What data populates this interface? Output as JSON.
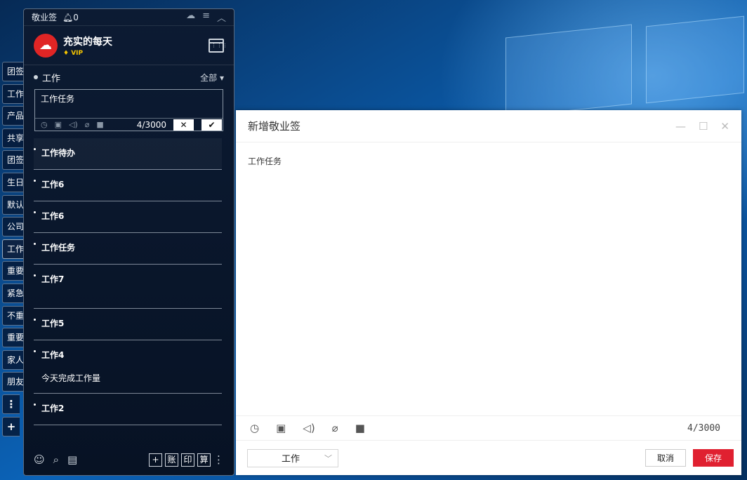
{
  "app": {
    "title": "敬业签",
    "notif_count": "0",
    "user_name": "充实的每天",
    "vip_label": "VIP"
  },
  "side_tabs": [
    {
      "label": "团签"
    },
    {
      "label": "工作"
    },
    {
      "label": "产品"
    },
    {
      "label": "共享"
    },
    {
      "label": "团签"
    },
    {
      "label": "生日"
    },
    {
      "label": "默认"
    },
    {
      "label": "公司"
    },
    {
      "label": "工作"
    },
    {
      "label": "重要"
    },
    {
      "label": "紧急"
    },
    {
      "label": "不重"
    },
    {
      "label": "重要"
    },
    {
      "label": "家人"
    },
    {
      "label": "朋友"
    }
  ],
  "side_more": "⋮",
  "side_add": "+",
  "section": {
    "title": "工作",
    "filter": "全部"
  },
  "editor": {
    "text": "工作任务",
    "count": "4/3000",
    "cancel": "✕",
    "confirm": "✔"
  },
  "notes": [
    {
      "title": "工作待办",
      "sub": ""
    },
    {
      "title": "工作6",
      "sub": ""
    },
    {
      "title": "工作6",
      "sub": ""
    },
    {
      "title": "工作任务",
      "sub": ""
    },
    {
      "title": "工作7",
      "sub": ""
    },
    {
      "title": "工作5",
      "sub": ""
    },
    {
      "title": "工作4",
      "sub": "今天完成工作量"
    },
    {
      "title": "工作2",
      "sub": ""
    }
  ],
  "footer": {
    "btn_add": "+",
    "btn_account": "账",
    "btn_print": "印",
    "btn_calc": "算"
  },
  "dialog": {
    "title": "新增敬业签",
    "content": "工作任务",
    "count": "4/3000",
    "category": "工作",
    "cancel_label": "取消",
    "save_label": "保存"
  },
  "colors": {
    "accent": "#e02030",
    "panel_bg": "#0c1b33"
  },
  "icons": [
    "bell-icon",
    "cloud-icon",
    "menu-icon",
    "collapse-icon",
    "calendar-icon",
    "clock-icon",
    "image-icon",
    "sound-icon",
    "attachment-icon",
    "stop-icon",
    "contacts-icon",
    "search-icon",
    "notes-icon",
    "minimize-icon",
    "maximize-icon",
    "close-icon",
    "chevron-down-icon"
  ]
}
